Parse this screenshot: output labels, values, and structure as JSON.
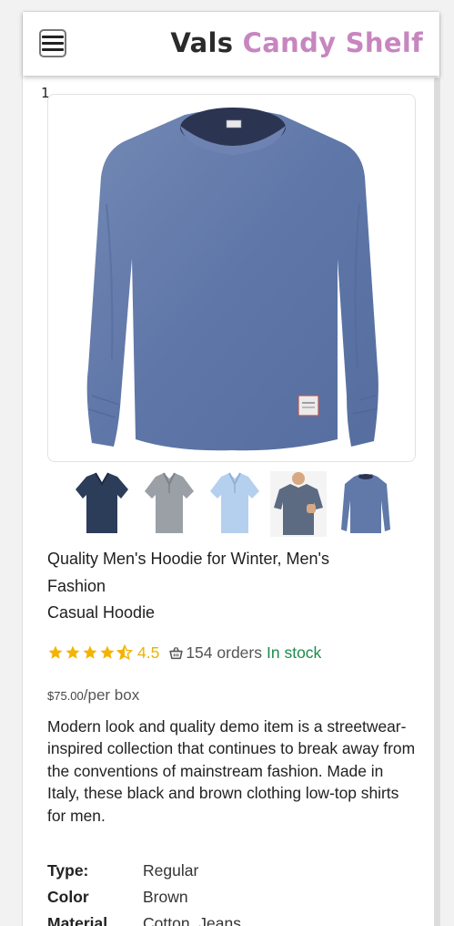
{
  "header": {
    "brand_part1": "Vals",
    "brand_part2": "Candy Shelf",
    "brand_color_primary": "#2b2b2b",
    "brand_color_accent": "#c786c0",
    "menu_icon": "hamburger-icon"
  },
  "content": {
    "index_label": "1",
    "main_image_icon": "blue-long-sleeve-shirt-image",
    "thumbnails": [
      {
        "icon": "navy-v-neck-tshirt-thumbnail"
      },
      {
        "icon": "grey-polo-shirt-thumbnail"
      },
      {
        "icon": "light-blue-polo-shirt-thumbnail"
      },
      {
        "icon": "model-wearing-polo-thumbnail"
      },
      {
        "icon": "blue-long-sleeve-shirt-thumbnail"
      }
    ],
    "title_lines": [
      "Quality Men's Hoodie for Winter, Men's",
      "Fashion",
      "Casual Hoodie"
    ],
    "rating": {
      "stars": 4.5,
      "value_text": "4.5",
      "orders_text": "154 orders",
      "stock_text": "In stock",
      "star_color": "#f5b301",
      "stock_color": "#1e8a4c"
    },
    "price": {
      "amount": "$75.00",
      "unit": "/per box"
    },
    "description": "Modern look and quality demo item is a streetwear-inspired collection that continues to break away from the conventions of mainstream fashion. Made in Italy, these black and brown clothing low-top shirts for men.",
    "specs": [
      {
        "key": "Type:",
        "value": "Regular"
      },
      {
        "key": "Color",
        "value": "Brown"
      },
      {
        "key": "Material",
        "value": "Cotton, Jeans"
      }
    ]
  }
}
